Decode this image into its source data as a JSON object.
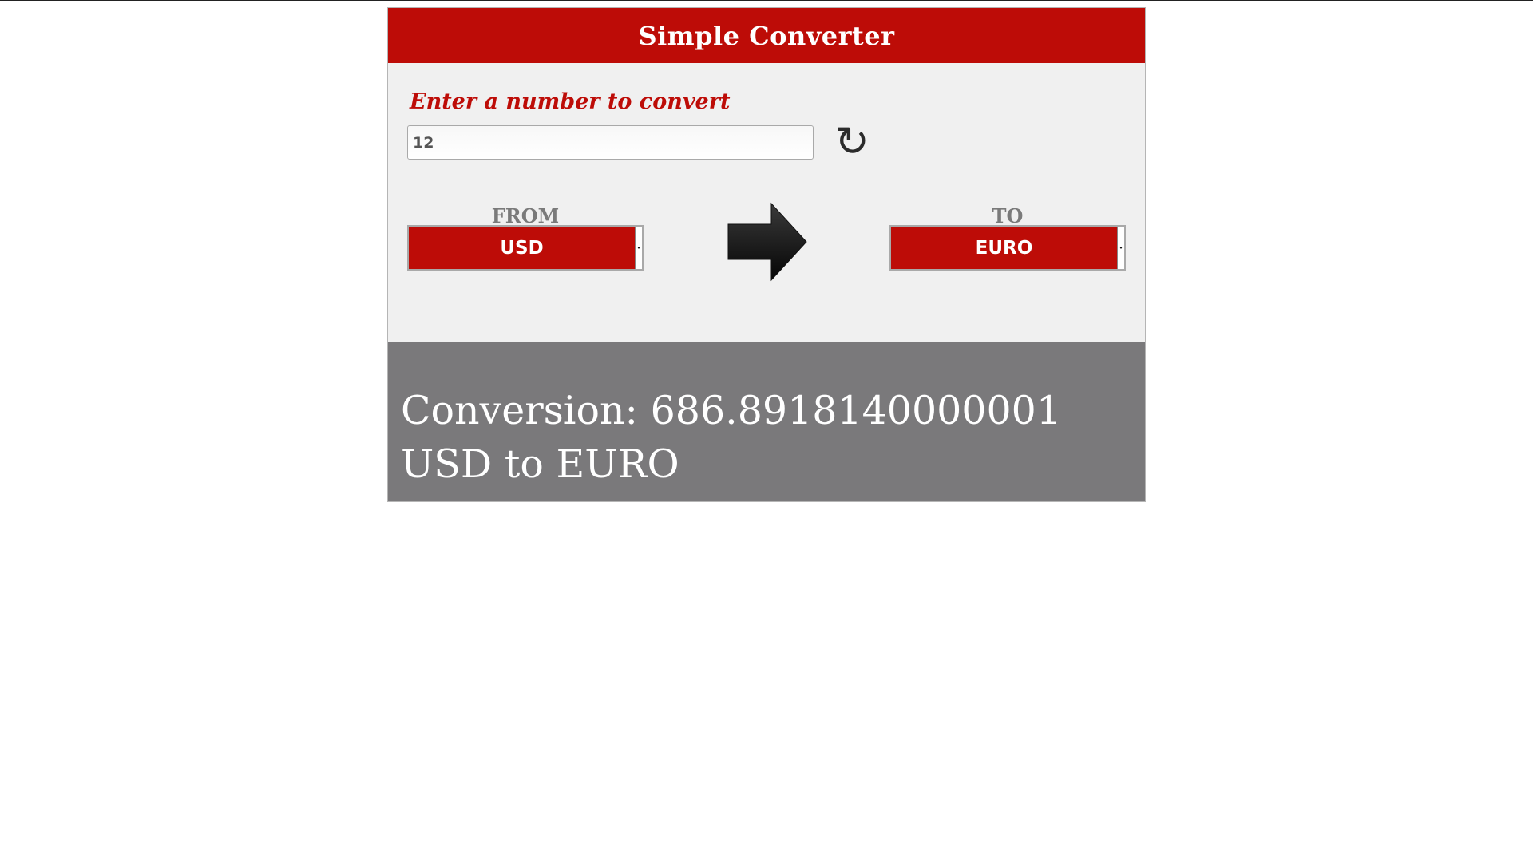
{
  "app": {
    "title": "Simple Converter"
  },
  "input": {
    "label": "Enter a number to convert",
    "value": "12"
  },
  "controls": {
    "reset_icon": "refresh-icon",
    "reset_glyph": "↻",
    "arrow_icon": "right-arrow-icon"
  },
  "from": {
    "label": "FROM",
    "selected": "USD"
  },
  "to": {
    "label": "TO",
    "selected": "EURO"
  },
  "result": {
    "text": "Conversion: 686.8918140000001 USD to EURO"
  },
  "colors": {
    "accent_red": "#bd0c07",
    "panel_bg": "#f0f0f0",
    "result_bg": "#7a797b",
    "label_gray": "#7a7a7a"
  }
}
